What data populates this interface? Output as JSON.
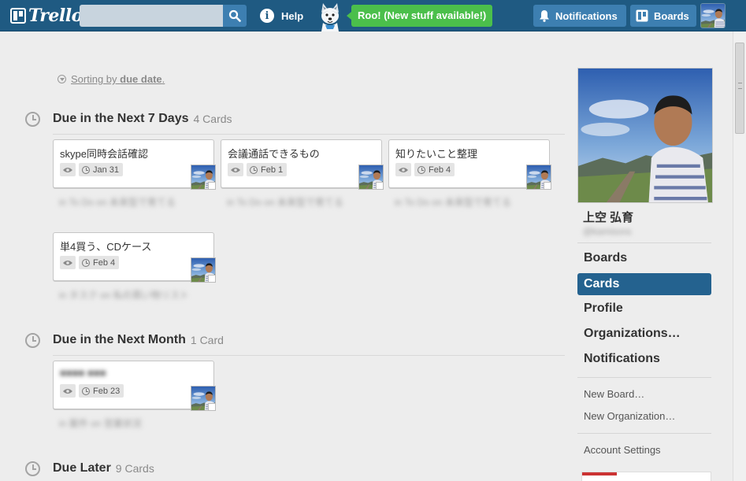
{
  "header": {
    "logo_text": "Trello",
    "search_placeholder": "",
    "help_label": "Help",
    "roo_label": "Roo! (New stuff available!)",
    "notifications_label": "Notifications",
    "boards_label": "Boards",
    "colors": {
      "bar": "#1f5a82",
      "button": "#3d7fb1",
      "roo": "#4bbf4b"
    }
  },
  "sorting": {
    "prefix": "Sorting by",
    "field": "due date",
    "suffix": "."
  },
  "sections": [
    {
      "title": "Due in the Next 7 Days",
      "count": "4 Cards",
      "cards": [
        {
          "title": "skype同時会話確認",
          "due": "Jan 31",
          "sub": "in To Do on 未来型で育てる"
        },
        {
          "title": "会議通話できるもの",
          "due": "Feb 1",
          "sub": "in To Do on 未来型で育てる"
        },
        {
          "title": "知りたいこと整理",
          "due": "Feb 4",
          "sub": "in To Do on 未来型で育てる"
        },
        {
          "title": "単4買う、CDケース",
          "due": "Feb 4",
          "sub": "in タスク on 私の買い物リスト"
        }
      ]
    },
    {
      "title": "Due in the Next Month",
      "count": "1 Card",
      "cards": [
        {
          "title": "■■■■ ■■■",
          "due": "Feb 23",
          "sub": "in 案件 on 営業状況"
        }
      ]
    },
    {
      "title": "Due Later",
      "count": "9 Cards",
      "cards": []
    }
  ],
  "sidebar": {
    "profile_name": "上空 弘育",
    "profile_handle": "@kamisora",
    "nav": [
      {
        "label": "Boards",
        "active": false
      },
      {
        "label": "Cards",
        "active": true
      },
      {
        "label": "Profile",
        "active": false
      },
      {
        "label": "Organizations…",
        "active": false
      },
      {
        "label": "Notifications",
        "active": false
      }
    ],
    "links": [
      "New Board…",
      "New Organization…"
    ],
    "settings_label": "Account Settings",
    "active_color": "#24628f"
  },
  "icons": {
    "search": "search-icon",
    "help": "help-icon",
    "bell": "bell-icon",
    "boards": "boards-icon",
    "eye": "eye-icon",
    "clock": "clock-icon",
    "mascot": "husky-mascot-icon"
  }
}
